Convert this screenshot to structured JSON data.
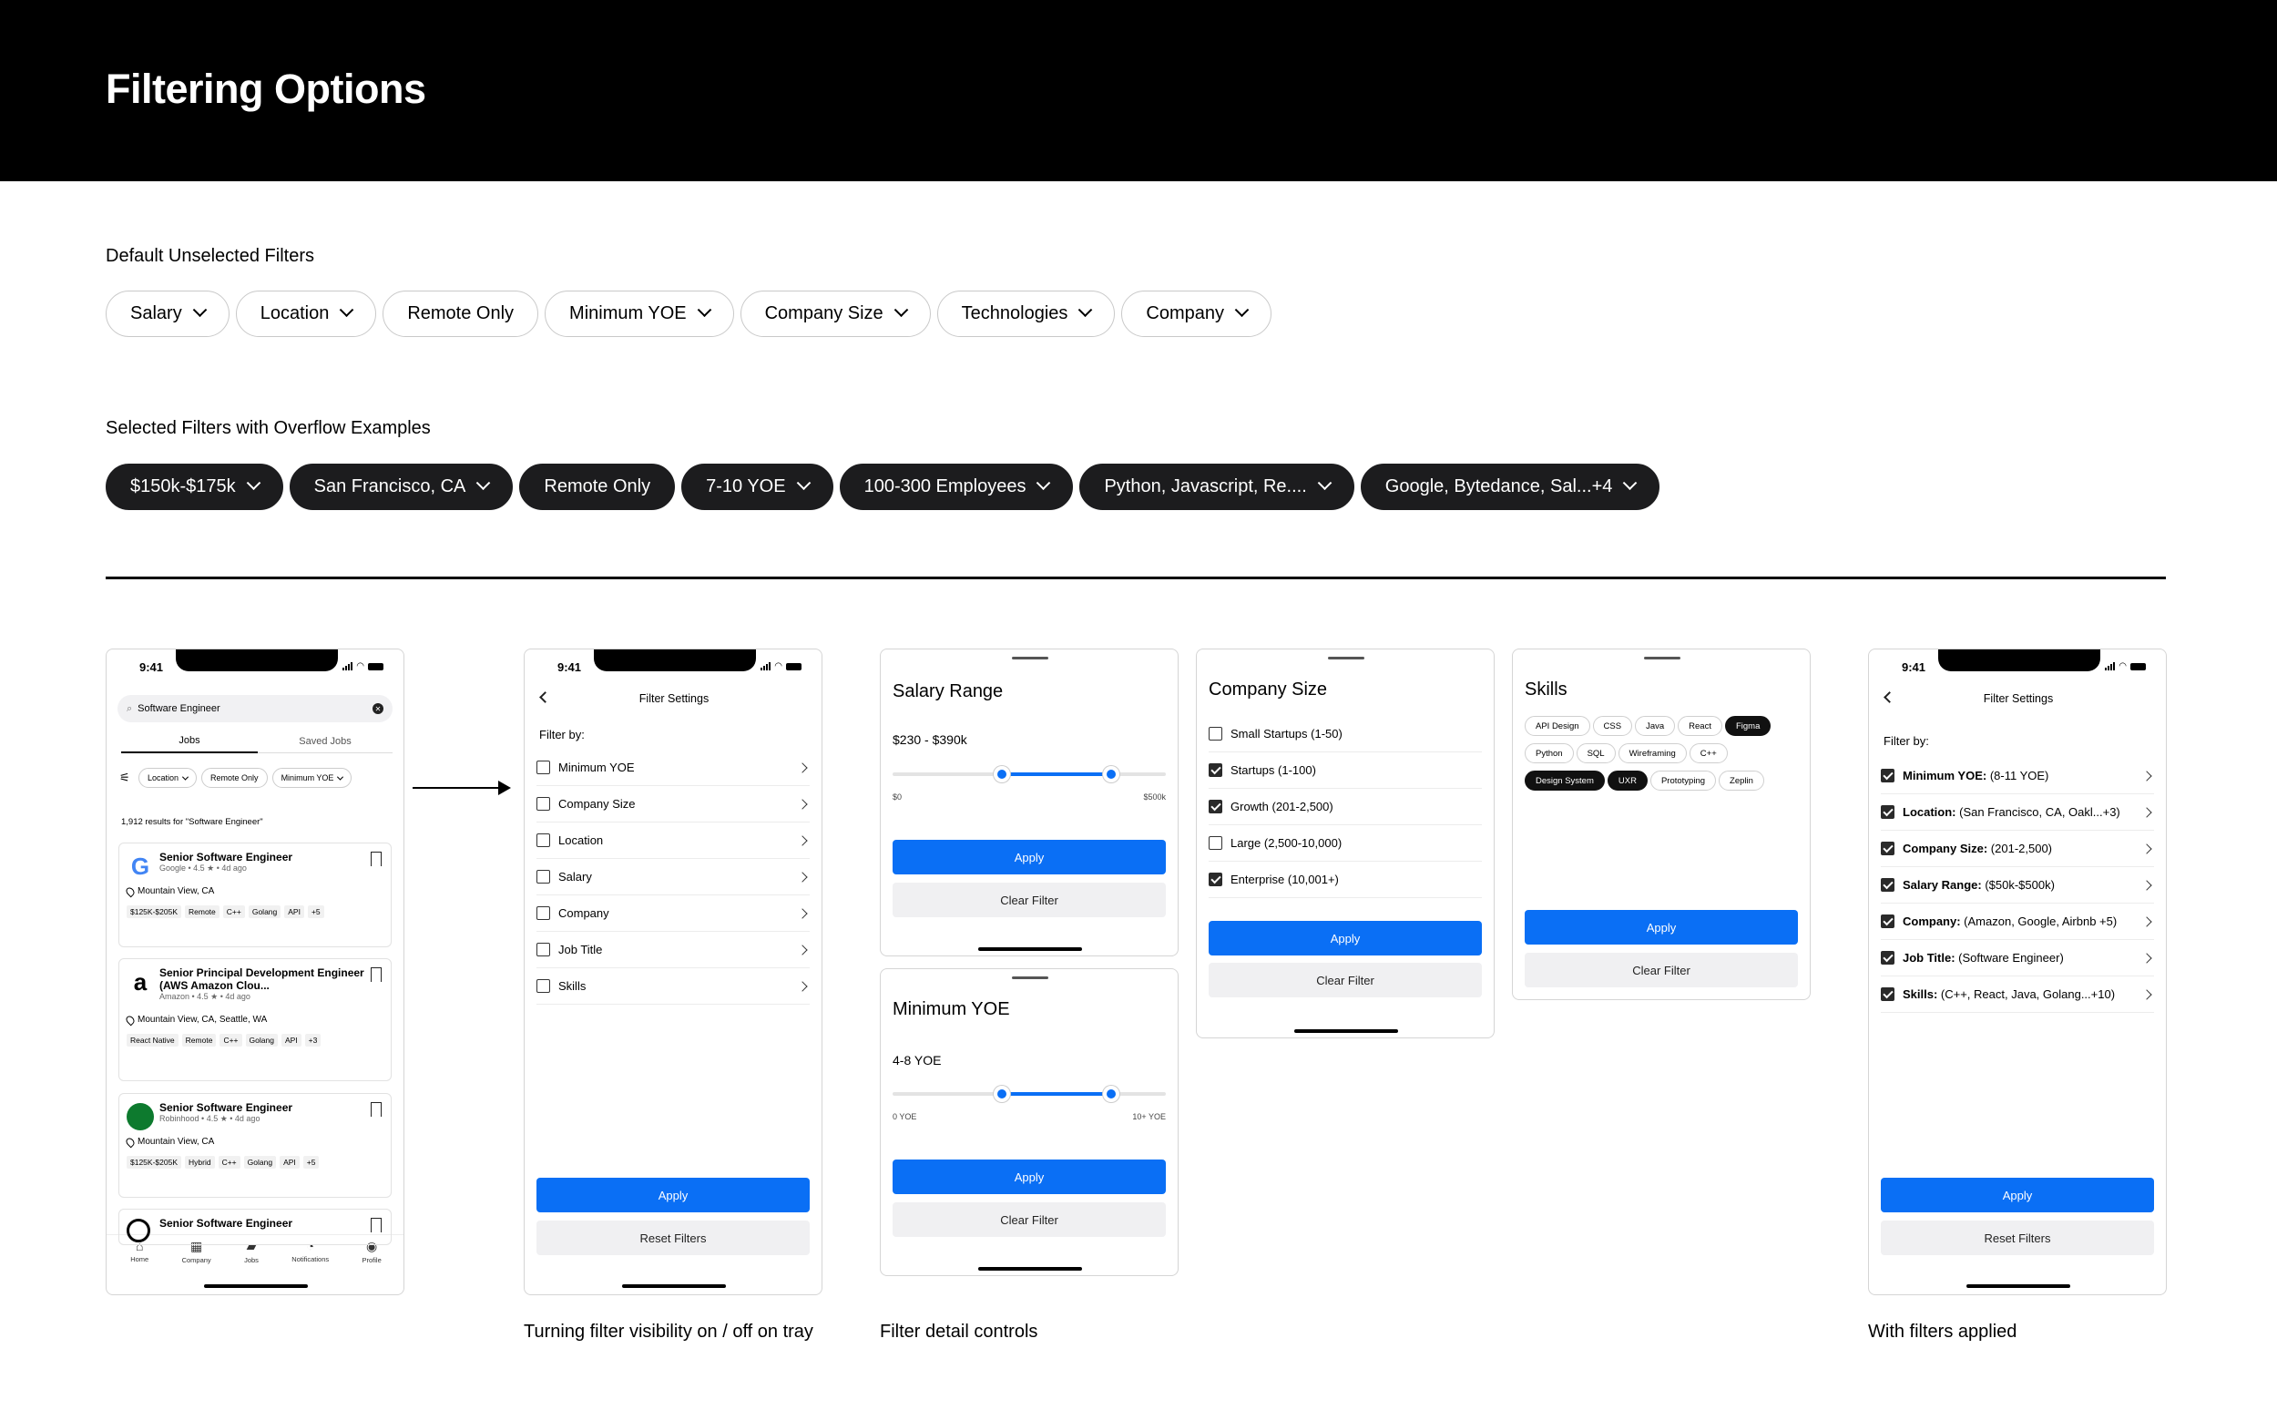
{
  "page_title": "Filtering Options",
  "default_section": {
    "title": "Default Unselected Filters",
    "chips": [
      "Salary",
      "Location",
      "Remote Only",
      "Minimum YOE",
      "Company Size",
      "Technologies",
      "Company"
    ]
  },
  "selected_section": {
    "title": "Selected Filters with Overflow Examples",
    "chips": [
      "$150k-$175k",
      "San Francisco, CA",
      "Remote Only",
      "7-10 YOE",
      "100-300 Employees",
      "Python, Javascript, Re....",
      "Google, Bytedance, Sal...+4"
    ]
  },
  "status_time": "9:41",
  "search_screen": {
    "search_value": "Software Engineer",
    "tabs": [
      "Jobs",
      "Saved Jobs"
    ],
    "filter_chips": [
      "Location",
      "Remote Only",
      "Minimum YOE"
    ],
    "results_text": "1,912 results for \"Software Engineer\"",
    "jobs": [
      {
        "title": "Senior Software Engineer",
        "meta": "Google • 4.5 ★ • 4d ago",
        "location": "Mountain View, CA",
        "tags": [
          "$125K-$205K",
          "Remote",
          "C++",
          "Golang",
          "API",
          "+5"
        ],
        "logo": "G",
        "logo_color": "#4285f4"
      },
      {
        "title": "Senior Principal Development Engineer (AWS Amazon Clou...",
        "meta": "Amazon • 4.5 ★ • 4d ago",
        "location": "Mountain View, CA, Seattle, WA",
        "tags": [
          "React Native",
          "Remote",
          "C++",
          "Golang",
          "API",
          "+3"
        ],
        "logo": "a",
        "logo_color": "#000"
      },
      {
        "title": "Senior Software Engineer",
        "meta": "Robinhood • 4.5 ★ • 4d ago",
        "location": "Mountain View, CA",
        "tags": [
          "$125K-$205K",
          "Hybrid",
          "C++",
          "Golang",
          "API",
          "+5"
        ],
        "logo": "",
        "logo_color": "#0d7a2e"
      },
      {
        "title": "Senior Software Engineer",
        "meta": "",
        "location": "",
        "tags": [],
        "logo": "",
        "logo_color": "#000"
      }
    ],
    "nav": [
      "Home",
      "Company",
      "Jobs",
      "Notifications",
      "Profile"
    ]
  },
  "filter_settings": {
    "title": "Filter Settings",
    "filter_by": "Filter by:",
    "items": [
      "Minimum YOE",
      "Company Size",
      "Location",
      "Salary",
      "Company",
      "Job Title",
      "Skills"
    ],
    "apply": "Apply",
    "reset": "Reset Filters"
  },
  "salary_panel": {
    "title": "Salary Range",
    "value": "$230 - $390k",
    "min_label": "$0",
    "max_label": "$500k",
    "low": 0.4,
    "high": 0.8,
    "apply": "Apply",
    "clear": "Clear Filter"
  },
  "yoe_panel": {
    "title": "Minimum YOE",
    "value": "4-8 YOE",
    "min_label": "0 YOE",
    "max_label": "10+ YOE",
    "low": 0.4,
    "high": 0.8,
    "apply": "Apply",
    "clear": "Clear Filter"
  },
  "company_size_panel": {
    "title": "Company Size",
    "options": [
      {
        "label": "Small Startups (1-50)",
        "checked": false
      },
      {
        "label": "Startups (1-100)",
        "checked": true
      },
      {
        "label": "Growth (201-2,500)",
        "checked": true
      },
      {
        "label": "Large (2,500-10,000)",
        "checked": false
      },
      {
        "label": "Enterprise (10,001+)",
        "checked": true
      }
    ],
    "apply": "Apply",
    "clear": "Clear Filter"
  },
  "skills_panel": {
    "title": "Skills",
    "tags": [
      {
        "label": "API Design",
        "on": false
      },
      {
        "label": "CSS",
        "on": false
      },
      {
        "label": "Java",
        "on": false
      },
      {
        "label": "React",
        "on": false
      },
      {
        "label": "Figma",
        "on": true
      },
      {
        "label": "Python",
        "on": false
      },
      {
        "label": "SQL",
        "on": false
      },
      {
        "label": "Wireframing",
        "on": false
      },
      {
        "label": "C++",
        "on": false
      },
      {
        "label": "Design System",
        "on": true
      },
      {
        "label": "UXR",
        "on": true
      },
      {
        "label": "Prototyping",
        "on": false
      },
      {
        "label": "Zeplin",
        "on": false
      }
    ],
    "apply": "Apply",
    "clear": "Clear Filter"
  },
  "applied_settings": {
    "title": "Filter Settings",
    "filter_by": "Filter by:",
    "items": [
      {
        "label": "Minimum YOE:",
        "value": " (8-11 YOE)"
      },
      {
        "label": "Location:",
        "value": " (San Francisco, CA, Oakl...+3)"
      },
      {
        "label": "Company Size:",
        "value": " (201-2,500)"
      },
      {
        "label": "Salary Range:",
        "value": " ($50k-$500k)"
      },
      {
        "label": "Company:",
        "value": " (Amazon, Google, Airbnb +5)"
      },
      {
        "label": "Job Title:",
        "value": " (Software Engineer)"
      },
      {
        "label": "Skills:",
        "value": " (C++, React, Java, Golang...+10)"
      }
    ],
    "apply": "Apply",
    "reset": "Reset Filters"
  },
  "captions": [
    "Turning filter visibility on / off on tray",
    "Filter detail controls",
    "With filters applied"
  ],
  "colors": {
    "accent": "#0a6ff5",
    "header_bg": "#000000",
    "chip_selected": "#1c1c1e"
  }
}
